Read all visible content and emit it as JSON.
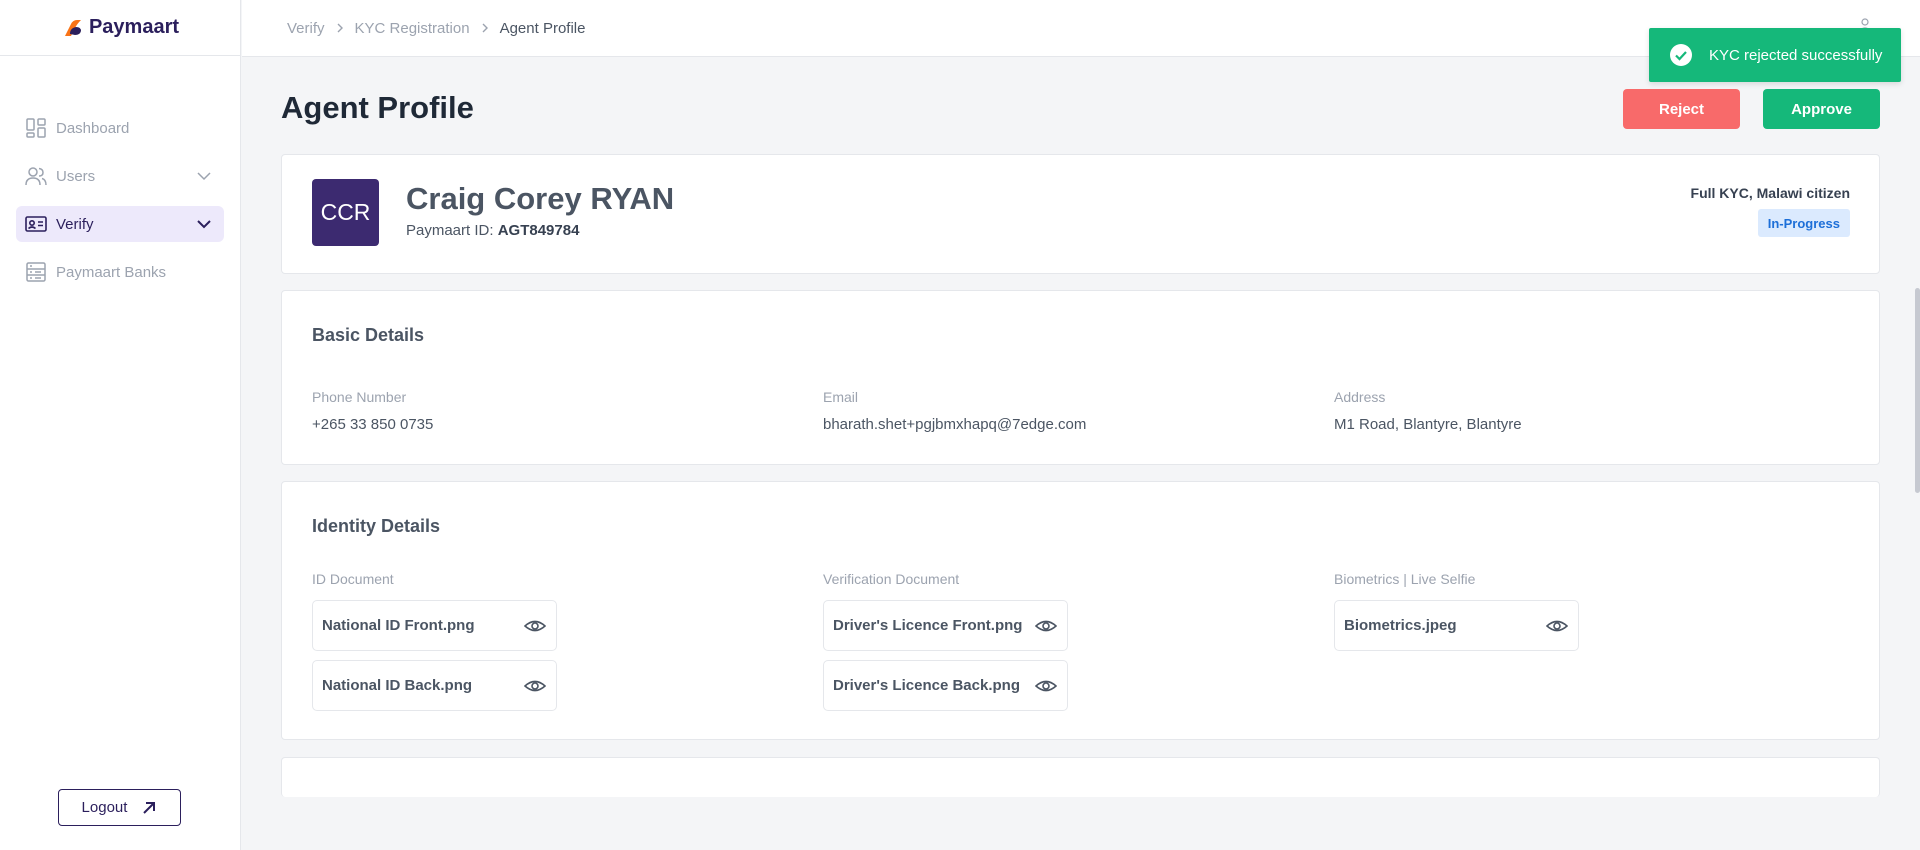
{
  "app": {
    "brand": "Paymaart"
  },
  "sidebar": {
    "items": [
      {
        "label": "Dashboard",
        "icon": "dashboard-icon"
      },
      {
        "label": "Users",
        "icon": "users-icon"
      },
      {
        "label": "Verify",
        "icon": "id-card-icon"
      },
      {
        "label": "Paymaart Banks",
        "icon": "banks-icon"
      }
    ],
    "logout_label": "Logout"
  },
  "breadcrumb": [
    "Verify",
    "KYC Registration",
    "Agent Profile"
  ],
  "page": {
    "title": "Agent Profile",
    "reject_label": "Reject",
    "approve_label": "Approve"
  },
  "profile": {
    "initials": "CCR",
    "name": "Craig Corey RYAN",
    "id_label": "Paymaart ID:",
    "id_value": "AGT849784",
    "kyc_type": "Full KYC, Malawi citizen",
    "status": "In-Progress"
  },
  "basic_details": {
    "title": "Basic Details",
    "phone_label": "Phone Number",
    "phone_value": "+265 33 850 0735",
    "email_label": "Email",
    "email_value": "bharath.shet+pgjbmxhapq@7edge.com",
    "address_label": "Address",
    "address_value": "M1 Road, Blantyre, Blantyre"
  },
  "identity_details": {
    "title": "Identity Details",
    "id_doc_label": "ID Document",
    "verification_doc_label": "Verification Document",
    "biometrics_label": "Biometrics | Live Selfie",
    "id_docs": [
      "National ID Front.png",
      "National ID Back.png"
    ],
    "verification_docs": [
      "Driver's Licence Front.png",
      "Driver's Licence Back.png"
    ],
    "biometrics_docs": [
      "Biometrics.jpeg"
    ]
  },
  "toast": {
    "message": "KYC rejected successfully"
  },
  "colors": {
    "brand": "#2b1f5c",
    "approve": "#15b87a",
    "reject": "#f86a6a",
    "status_badge_bg": "#dbeafe",
    "status_badge_text": "#1d6fd8"
  }
}
